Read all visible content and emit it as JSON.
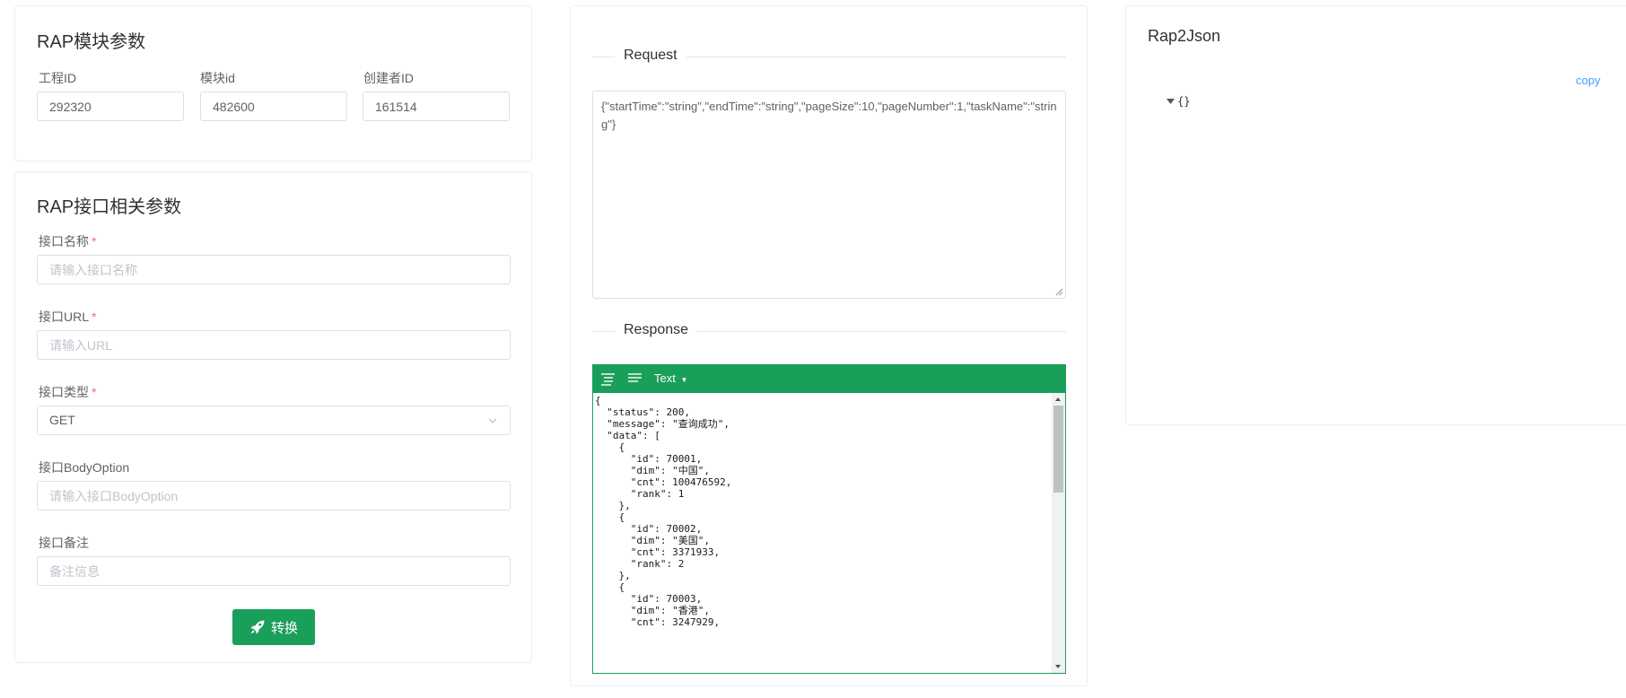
{
  "module_params": {
    "title": "RAP模块参数",
    "project_id": {
      "label": "工程ID",
      "value": "292320"
    },
    "module_id": {
      "label": "模块id",
      "value": "482600"
    },
    "creator_id": {
      "label": "创建者ID",
      "value": "161514"
    }
  },
  "api_params": {
    "title": "RAP接口相关参数",
    "required_mark": "*",
    "api_name": {
      "label": "接口名称",
      "placeholder": "请输入接口名称"
    },
    "api_url": {
      "label": "接口URL",
      "placeholder": "请输入URL"
    },
    "api_type": {
      "label": "接口类型",
      "value": "GET"
    },
    "body_option": {
      "label": "接口BodyOption",
      "placeholder": "请输入接口BodyOption"
    },
    "remark": {
      "label": "接口备注",
      "placeholder": "备注信息"
    },
    "convert_button": {
      "label": "转换",
      "icon": "rocket-icon"
    }
  },
  "request": {
    "label": "Request",
    "body": "{\"startTime\":\"string\",\"endTime\":\"string\",\"pageSize\":10,\"pageNumber\":1,\"taskName\":\"string\"}"
  },
  "response": {
    "label": "Response",
    "mode": "Text",
    "content": "{\n  \"status\": 200,\n  \"message\": \"查询成功\",\n  \"data\": [\n    {\n      \"id\": 70001,\n      \"dim\": \"中国\",\n      \"cnt\": 100476592,\n      \"rank\": 1\n    },\n    {\n      \"id\": 70002,\n      \"dim\": \"美国\",\n      \"cnt\": 3371933,\n      \"rank\": 2\n    },\n    {\n      \"id\": 70003,\n      \"dim\": \"香港\",\n      \"cnt\": 3247929,"
  },
  "rap2json": {
    "title": "Rap2Json",
    "copy_label": "copy",
    "tree_root": "{}"
  },
  "colors": {
    "accent_green": "#1a9f5a",
    "link_blue": "#409eff",
    "required_red": "#f56c6c"
  }
}
